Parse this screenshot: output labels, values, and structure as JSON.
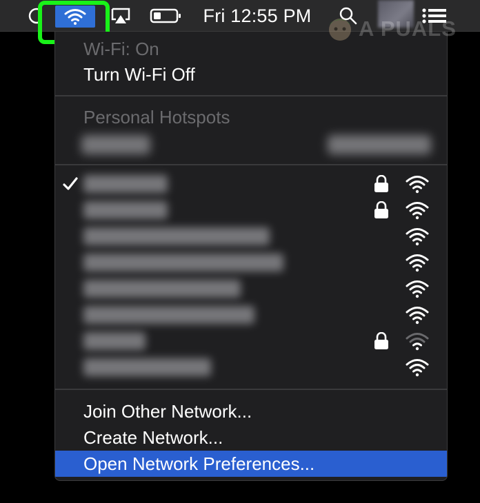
{
  "menubar": {
    "clock": "Fri 12:55 PM",
    "icons": [
      "wifi-icon",
      "airplay-icon",
      "battery-icon",
      "search-icon",
      "list-icon"
    ]
  },
  "watermark": {
    "text": "A PUALS"
  },
  "wifi_menu": {
    "status": "Wi-Fi: On",
    "toggle_label": "Turn Wi-Fi Off",
    "hotspots_header": "Personal Hotspots",
    "networks": [
      {
        "connected": true,
        "locked": true,
        "signal": "full"
      },
      {
        "connected": false,
        "locked": true,
        "signal": "full"
      },
      {
        "connected": false,
        "locked": false,
        "signal": "full"
      },
      {
        "connected": false,
        "locked": false,
        "signal": "full"
      },
      {
        "connected": false,
        "locked": false,
        "signal": "full"
      },
      {
        "connected": false,
        "locked": false,
        "signal": "full"
      },
      {
        "connected": false,
        "locked": true,
        "signal": "low"
      },
      {
        "connected": false,
        "locked": false,
        "signal": "full"
      }
    ],
    "actions": {
      "join_other": "Join Other Network...",
      "create_network": "Create Network...",
      "open_prefs": "Open Network Preferences..."
    }
  },
  "colors": {
    "accent": "#2a5fd0",
    "highlight": "#19f219",
    "menu_bg": "#1f1f21"
  }
}
